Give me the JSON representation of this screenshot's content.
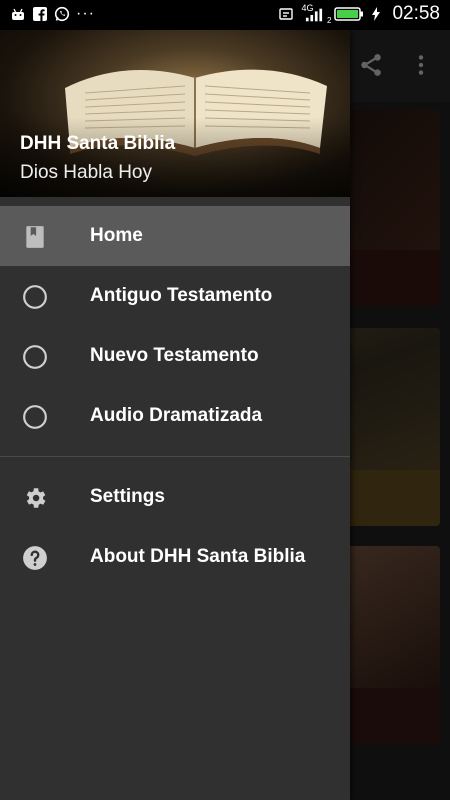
{
  "status_bar": {
    "time": "02:58",
    "network": "4G",
    "signal_sub": "2",
    "icons": [
      "android-icon",
      "facebook-icon",
      "whatsapp-icon",
      "more-icon"
    ],
    "right_icons": [
      "notification-icon",
      "signal-icon",
      "battery-icon",
      "charging-icon"
    ],
    "battery_color": "#46d046"
  },
  "drawer": {
    "title": "DHH Santa Biblia",
    "subtitle": "Dios Habla Hoy",
    "items": [
      {
        "label": "Home",
        "icon": "book-icon",
        "active": true
      },
      {
        "label": "Antiguo Testamento",
        "icon": "radio-icon",
        "active": false
      },
      {
        "label": "Nuevo Testamento",
        "icon": "radio-icon",
        "active": false
      },
      {
        "label": "Audio Dramatizada",
        "icon": "radio-icon",
        "active": false
      }
    ],
    "secondary_items": [
      {
        "label": "Settings",
        "icon": "gear-icon"
      },
      {
        "label": "About DHH Santa Biblia",
        "icon": "help-icon"
      }
    ]
  },
  "background": {
    "toolbar_icons": [
      "share-icon",
      "more-vert-icon"
    ]
  }
}
